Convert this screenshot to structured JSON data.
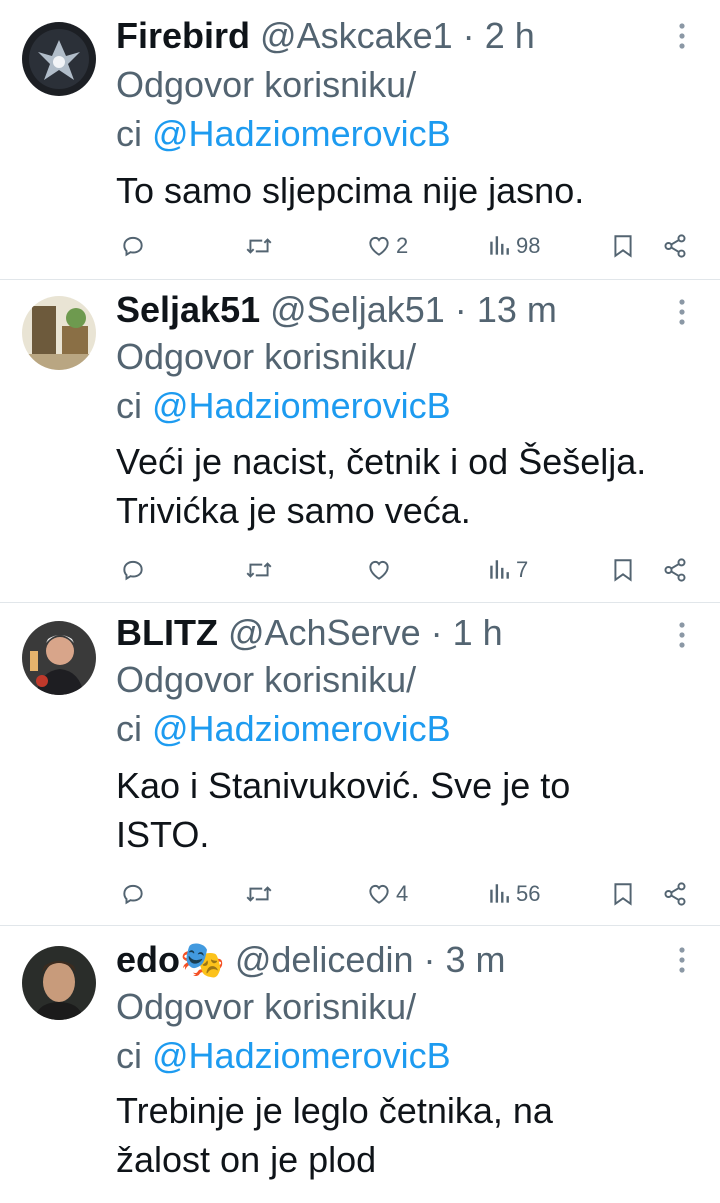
{
  "reply_prefix": "Odgovor korisniku/",
  "reply_prefix2": "ci ",
  "reply_target": "@HadziomerovicB",
  "tweets": [
    {
      "name": "Firebird",
      "handle": "@Askcake1",
      "dot": "·",
      "time": "2 h",
      "lines": [
        "To samo sljepcima nije jasno."
      ],
      "likes": "2",
      "views": "98"
    },
    {
      "name": "Seljak51",
      "handle": "@Seljak51",
      "dot": "·",
      "time": "13 m",
      "lines": [
        "Veći je nacist, četnik i od Šešelja.",
        "Trivićka je samo veća."
      ],
      "likes": "",
      "views": "7"
    },
    {
      "name": "BLITZ",
      "handle": "@AchServe",
      "dot": "·",
      "time": "1 h",
      "lines": [
        "Kao i Stanivuković. Sve je to",
        "ISTO."
      ],
      "likes": "4",
      "views": "56"
    },
    {
      "name": "edo🎭",
      "handle": "@delicedin",
      "dot": "·",
      "time": "3 m",
      "lines": [
        "Trebinje je leglo četnika, na",
        "žalost on je plod"
      ],
      "likes": "",
      "views": ""
    }
  ],
  "colors": {
    "accent": "#1d9bf0",
    "muted": "#536471",
    "text": "#0f1419",
    "divider": "#e1e6ea"
  },
  "icons": [
    "reply-icon",
    "retweet-icon",
    "like-icon",
    "views-icon",
    "bookmark-icon",
    "share-icon",
    "more-icon"
  ]
}
